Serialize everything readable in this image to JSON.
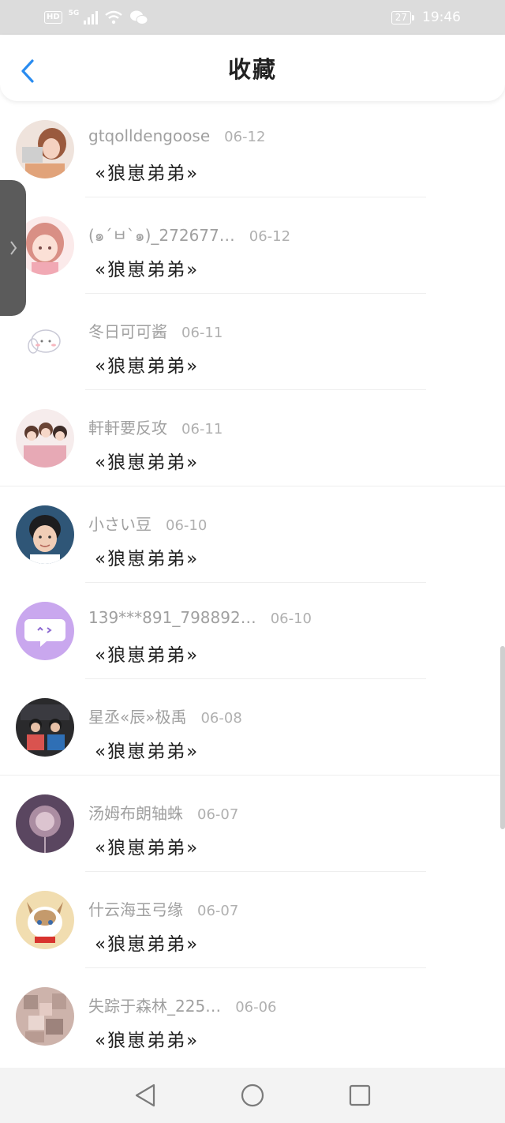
{
  "status_bar": {
    "hd": "HD",
    "network": "5G",
    "battery": "27",
    "time": "19:46"
  },
  "header": {
    "title": "收藏",
    "back_icon": "chevron-left-icon",
    "accent_color": "#2a8cf0"
  },
  "items": [
    {
      "user": "gtqolldengoose",
      "date": "06-12",
      "text": "«狼崽弟弟»",
      "avatar_color": "#d9a08a"
    },
    {
      "user": "(๑´ㅂ`๑)_272677…",
      "date": "06-12",
      "text": "«狼崽弟弟»",
      "avatar_color": "#f1c7c0"
    },
    {
      "user": "冬日可可酱",
      "date": "06-11",
      "text": "«狼崽弟弟»",
      "avatar_color": "#fbf7f7"
    },
    {
      "user": "軒軒要反攻",
      "date": "06-11",
      "text": "«狼崽弟弟»",
      "avatar_color": "#e8c8c0"
    },
    {
      "user": "小さい豆",
      "date": "06-10",
      "text": "«狼崽弟弟»",
      "avatar_color": "#274a6b"
    },
    {
      "user": "139***891_798892…",
      "date": "06-10",
      "text": "«狼崽弟弟»",
      "avatar_color": "#c9a7ee"
    },
    {
      "user": "星丞«辰»极禹",
      "date": "06-08",
      "text": "«狼崽弟弟»",
      "avatar_color": "#2b2b2b"
    },
    {
      "user": "汤姆布朗轴蛛",
      "date": "06-07",
      "text": "«狼崽弟弟»",
      "avatar_color": "#6a5566"
    },
    {
      "user": "什云海玉弓缘",
      "date": "06-07",
      "text": "«狼崽弟弟»",
      "avatar_color": "#e9c689"
    },
    {
      "user": "失踪于森林_225…",
      "date": "06-06",
      "text": "«狼崽弟弟»",
      "avatar_color": "#c7a8a1"
    }
  ],
  "nav": {
    "back": "triangle-back-icon",
    "home": "circle-home-icon",
    "recents": "square-recents-icon"
  }
}
